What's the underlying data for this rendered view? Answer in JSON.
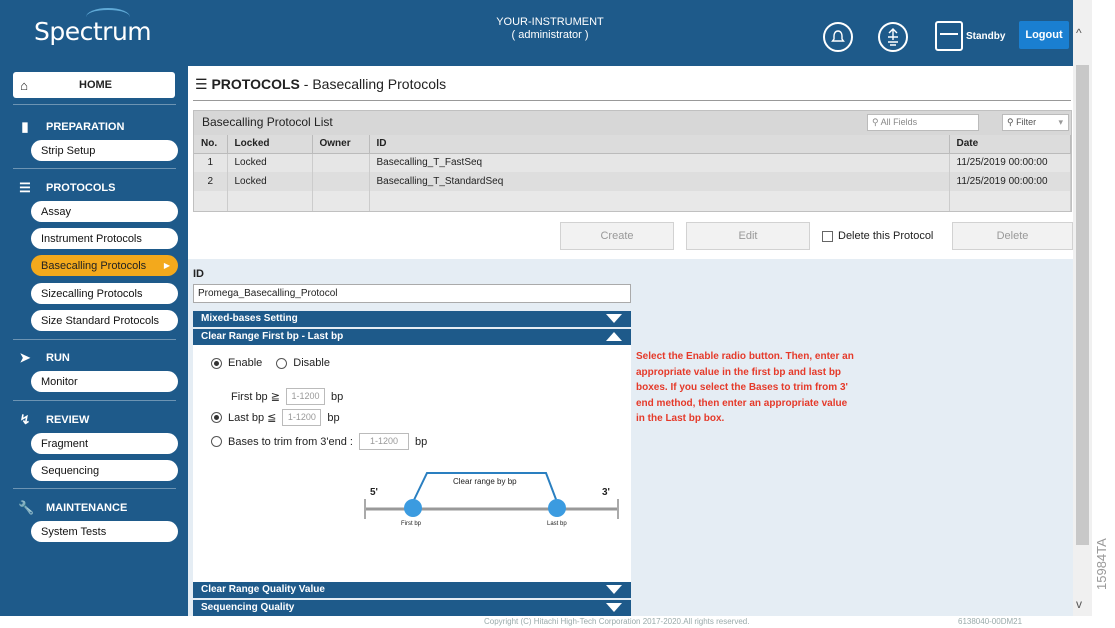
{
  "header": {
    "app_name": "Spectrum",
    "instrument_name": "YOUR-INSTRUMENT",
    "user_role": "( administrator )",
    "status": "Standby",
    "logout_label": "Logout"
  },
  "sidebar": {
    "home": "HOME",
    "sections": [
      {
        "title": "PREPARATION",
        "icon": "preparation-icon",
        "items": [
          "Strip Setup"
        ]
      },
      {
        "title": "PROTOCOLS",
        "icon": "list-icon",
        "items": [
          "Assay",
          "Instrument Protocols",
          "Basecalling Protocols",
          "Sizecalling Protocols",
          "Size Standard Protocols"
        ]
      },
      {
        "title": "RUN",
        "icon": "run-icon",
        "items": [
          "Monitor"
        ]
      },
      {
        "title": "REVIEW",
        "icon": "chart-icon",
        "items": [
          "Fragment",
          "Sequencing"
        ]
      },
      {
        "title": "MAINTENANCE",
        "icon": "wrench-icon",
        "items": [
          "System Tests"
        ]
      }
    ],
    "active_item": "Basecalling Protocols"
  },
  "page": {
    "title_bold": "PROTOCOLS",
    "title_rest": " - Basecalling Protocols"
  },
  "list": {
    "title": "Basecalling Protocol List",
    "search_placeholder": "All Fields",
    "filter_label": "Filter",
    "columns": [
      "No.",
      "Locked",
      "Owner",
      "ID",
      "Date"
    ],
    "rows": [
      {
        "no": "1",
        "locked": "Locked",
        "owner": "",
        "id": "Basecalling_T_FastSeq",
        "date": "11/25/2019 00:00:00"
      },
      {
        "no": "2",
        "locked": "Locked",
        "owner": "",
        "id": "Basecalling_T_StandardSeq",
        "date": "11/25/2019 00:00:00"
      }
    ]
  },
  "actions": {
    "create": "Create",
    "edit": "Edit",
    "delete_checkbox": "Delete this Protocol",
    "delete": "Delete"
  },
  "editor": {
    "id_label": "ID",
    "id_value": "Promega_Basecalling_Protocol",
    "mixed_bases": "Mixed-bases Setting",
    "clear_range_bp": "Clear Range First bp - Last bp",
    "enable": "Enable",
    "disable": "Disable",
    "first_bp": "First bp ≧",
    "last_bp": "Last bp ≦",
    "trim_3": "Bases to trim from 3'end :",
    "range_placeholder": "1-1200",
    "unit_bp": "bp",
    "diagram": {
      "left_end": "5'",
      "right_end": "3'",
      "label": "Clear range by bp",
      "first_marker": "First bp",
      "last_marker": "Last bp"
    },
    "clear_range_quality": "Clear Range Quality Value",
    "sequencing_quality": "Sequencing Quality"
  },
  "hint": "Select the Enable radio button. Then, enter an appropriate value in the first bp and last bp boxes. If you select the Bases to trim from 3' end method, then enter an appropriate value in the Last bp box.",
  "footer": {
    "copyright": "Copyright (C) Hitachi High-Tech Corporation 2017-2020.All rights reserved.",
    "version": "6138040-00DM21"
  },
  "figure_code": "15984TA",
  "colors": {
    "primary": "#1e5a8a",
    "active": "#f3a91c",
    "hint": "#e53a2a",
    "logout": "#1a7fd1"
  }
}
